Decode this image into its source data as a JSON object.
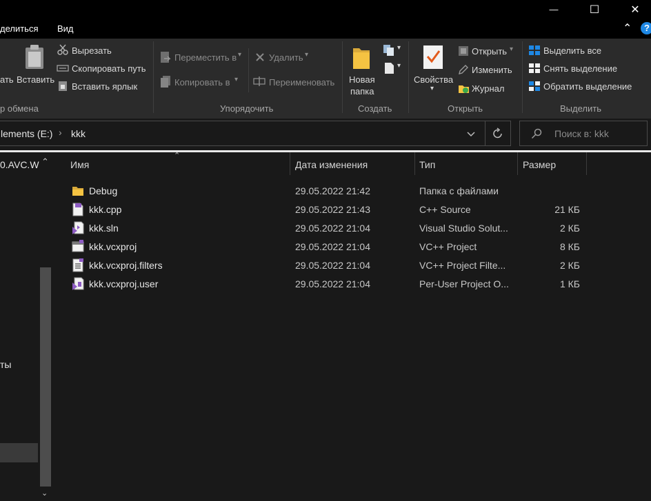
{
  "window": {
    "minimize_glyph": "—",
    "maximize_glyph": "☐",
    "close_glyph": "✕"
  },
  "menu": {
    "tabs": [
      "делиться",
      "Вид"
    ],
    "collapse_glyph": "⌃",
    "help_glyph": "?"
  },
  "ribbon": {
    "clipboard": {
      "label": "р обмена",
      "pin_partial": "ать",
      "paste": "Вставить",
      "cut": "Вырезать",
      "copy_path": "Скопировать путь",
      "paste_shortcut": "Вставить ярлык"
    },
    "organize": {
      "label": "Упорядочить",
      "move_to": "Переместить в",
      "copy_to": "Копировать в",
      "delete": "Удалить",
      "rename": "Переименовать"
    },
    "create": {
      "label": "Создать",
      "new_folder_line1": "Новая",
      "new_folder_line2": "папка"
    },
    "open": {
      "label": "Открыть",
      "properties": "Свойства",
      "open": "Открыть",
      "edit": "Изменить",
      "history": "Журнал"
    },
    "select": {
      "label": "Выделить",
      "select_all": "Выделить все",
      "select_none": "Снять выделение",
      "invert": "Обратить выделение"
    }
  },
  "address": {
    "drive": "lements (E:)",
    "folder": "kkk",
    "search_placeholder": "Поиск в: kkk"
  },
  "nav": {
    "top_item": "0.AVC.W",
    "mid_item": "ты"
  },
  "columns": {
    "name": "Имя",
    "date": "Дата изменения",
    "type": "Тип",
    "size": "Размер"
  },
  "files": [
    {
      "name": "Debug",
      "date": "29.05.2022 21:42",
      "type": "Папка с файлами",
      "size": "",
      "icon": "folder-icon"
    },
    {
      "name": "kkk.cpp",
      "date": "29.05.2022 21:43",
      "type": "C++ Source",
      "size": "21 КБ",
      "icon": "cpp-file-icon"
    },
    {
      "name": "kkk.sln",
      "date": "29.05.2022 21:04",
      "type": "Visual Studio Solut...",
      "size": "2 КБ",
      "icon": "vs-solution-icon"
    },
    {
      "name": "kkk.vcxproj",
      "date": "29.05.2022 21:04",
      "type": "VC++ Project",
      "size": "8 КБ",
      "icon": "vcxproj-file-icon"
    },
    {
      "name": "kkk.vcxproj.filters",
      "date": "29.05.2022 21:04",
      "type": "VC++ Project Filte...",
      "size": "2 КБ",
      "icon": "filters-file-icon"
    },
    {
      "name": "kkk.vcxproj.user",
      "date": "29.05.2022 21:04",
      "type": "Per-User Project O...",
      "size": "1 КБ",
      "icon": "user-file-icon"
    }
  ],
  "colors": {
    "background": "#191919",
    "ribbon": "#2b2b2b",
    "accent_blue": "#1e88e5",
    "folder_yellow": "#f5c342"
  }
}
